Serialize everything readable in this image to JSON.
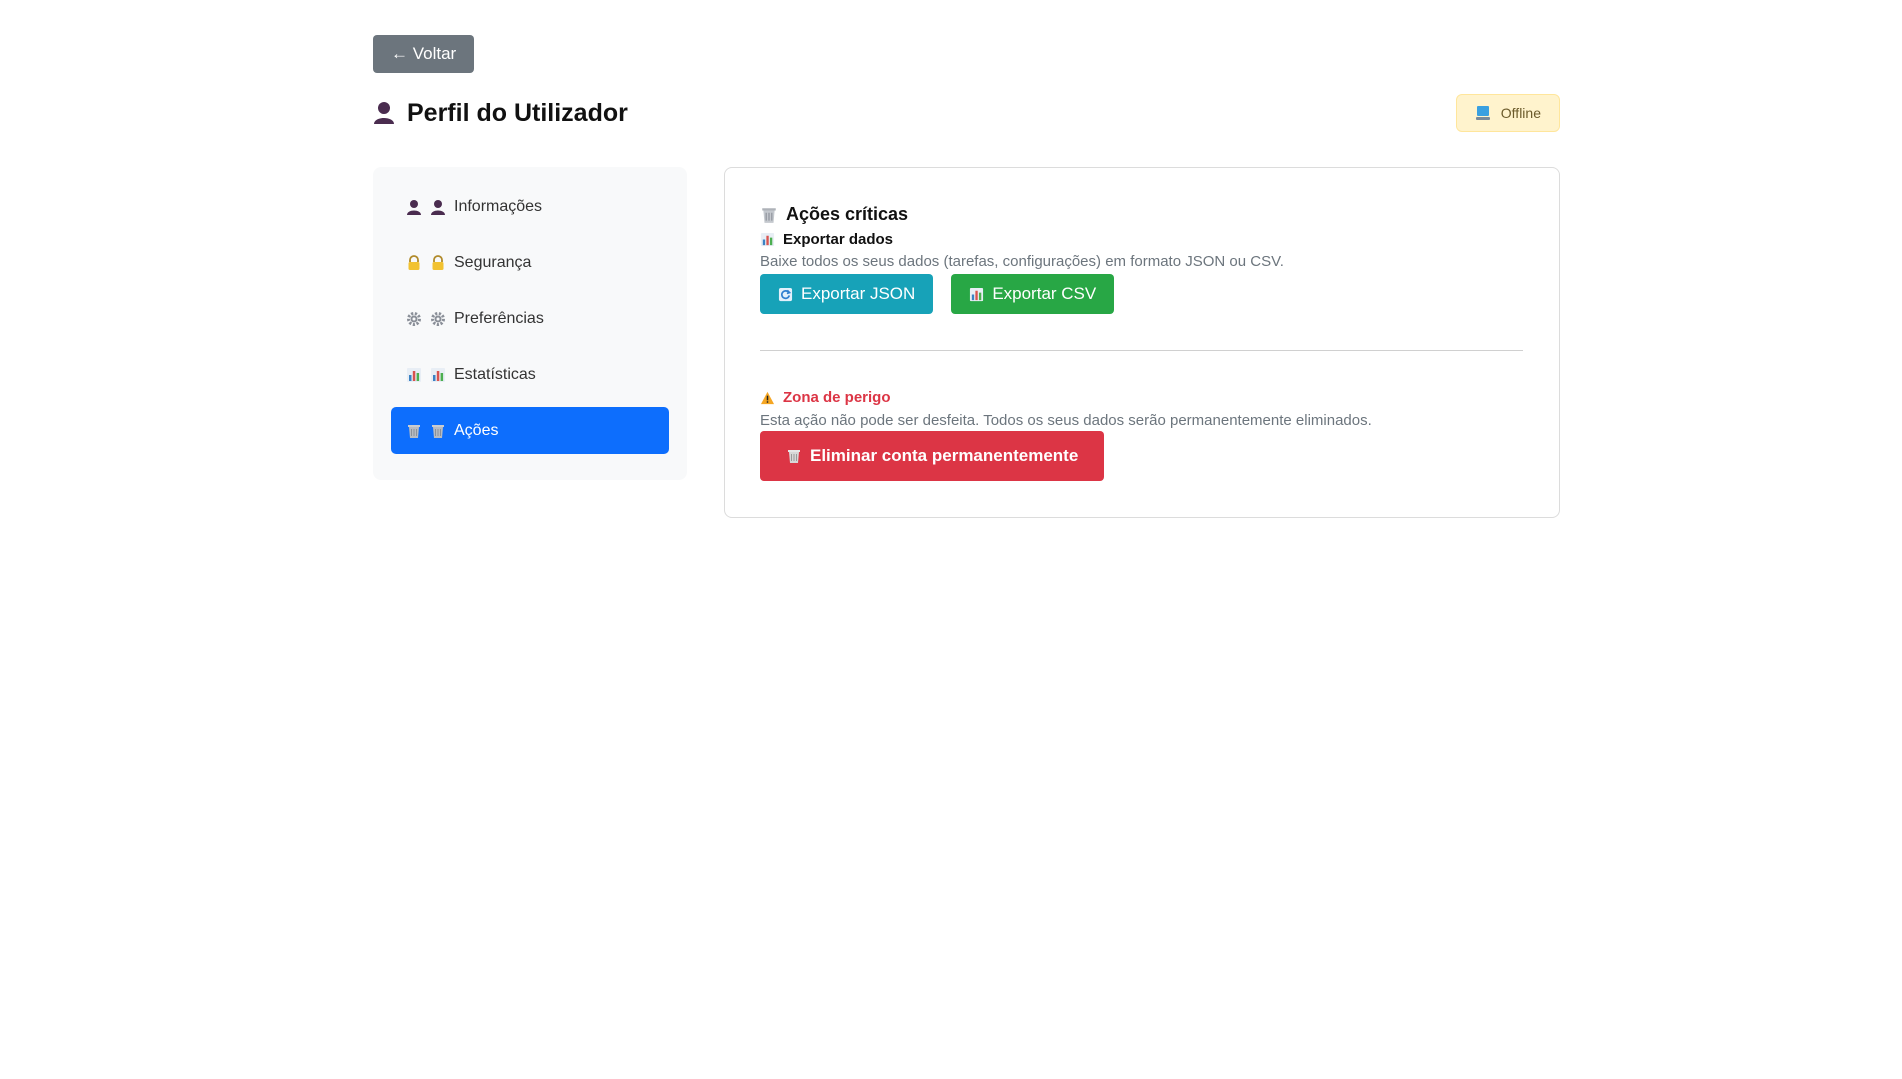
{
  "back_button": {
    "label": "← Voltar"
  },
  "header": {
    "title": "Perfil do Utilizador",
    "status": "Offline"
  },
  "sidebar": {
    "items": [
      {
        "label": "Informações",
        "icon": "user-icon",
        "active": false
      },
      {
        "label": "Segurança",
        "icon": "lock-icon",
        "active": false
      },
      {
        "label": "Preferências",
        "icon": "gear-icon",
        "active": false
      },
      {
        "label": "Estatísticas",
        "icon": "bar-chart-icon",
        "active": false
      },
      {
        "label": "Ações",
        "icon": "trash-icon",
        "active": true
      }
    ]
  },
  "main": {
    "section_title": "Ações críticas",
    "export": {
      "title": "Exportar dados",
      "description": "Baixe todos os seus dados (tarefas, configurações) em formato JSON ou CSV.",
      "json_button": "Exportar JSON",
      "csv_button": "Exportar CSV"
    },
    "danger": {
      "title": "Zona de perigo",
      "description": "Esta ação não pode ser desfeita. Todos os seus dados serão permanentemente eliminados.",
      "delete_button": "Eliminar conta permanentemente"
    }
  },
  "colors": {
    "primary": "#0d6efd",
    "secondary": "#6c757d",
    "info": "#17a2b8",
    "success": "#28a745",
    "danger": "#dc3545",
    "warning_bg": "#fff3cd"
  }
}
